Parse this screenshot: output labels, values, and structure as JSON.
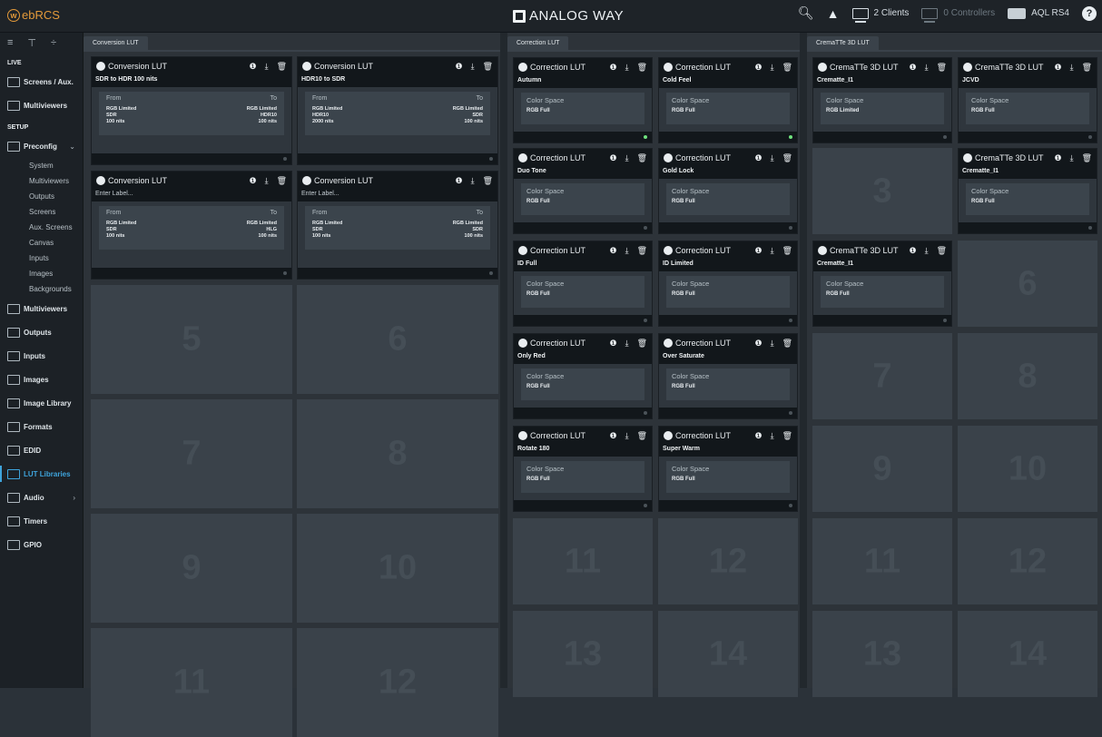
{
  "app": {
    "name": "ebRCS",
    "brand": "ANALOG WAY",
    "clients": "2 Clients",
    "controllers": "0 Controllers",
    "device": "AQL RS4",
    "help": "?"
  },
  "sidebar": {
    "live": "LIVE",
    "setup": "SETUP",
    "live_items": [
      "Screens / Aux.",
      "Multiviewers"
    ],
    "preconfig": "Preconfig",
    "preconfig_sub": [
      "System",
      "Multiviewers",
      "Outputs",
      "Screens",
      "Aux. Screens",
      "Canvas",
      "Inputs",
      "Images",
      "Backgrounds"
    ],
    "items": [
      "Multiviewers",
      "Outputs",
      "Inputs",
      "Images",
      "Image Library",
      "Formats",
      "EDID",
      "LUT Libraries",
      "Audio",
      "Timers",
      "GPIO"
    ]
  },
  "conversion": {
    "tab": "Conversion LUT",
    "cards": [
      {
        "title": "Conversion LUT",
        "label": "SDR to HDR 100 nits",
        "from_label": "From",
        "to_label": "To",
        "from": [
          "RGB Limited",
          "SDR",
          "100 nits"
        ],
        "to": [
          "RGB Limited",
          "HDR10",
          "100 nits"
        ]
      },
      {
        "title": "Conversion LUT",
        "label": "HDR10 to SDR",
        "from_label": "From",
        "to_label": "To",
        "from": [
          "RGB Limited",
          "HDR10",
          "2000 nits"
        ],
        "to": [
          "RGB Limited",
          "SDR",
          "100 nits"
        ]
      },
      {
        "title": "Conversion LUT",
        "label": "Enter Label...",
        "from_label": "From",
        "to_label": "To",
        "from": [
          "RGB Limited",
          "SDR",
          "100 nits"
        ],
        "to": [
          "RGB Limited",
          "HLG",
          "100 nits"
        ]
      },
      {
        "title": "Conversion LUT",
        "label": "Enter Label...",
        "from_label": "From",
        "to_label": "To",
        "from": [
          "RGB Limited",
          "SDR",
          "100 nits"
        ],
        "to": [
          "RGB Limited",
          "SDR",
          "100 nits"
        ]
      }
    ],
    "empty": [
      "5",
      "6",
      "7",
      "8",
      "9",
      "10",
      "11",
      "12"
    ]
  },
  "correction": {
    "tab": "Correction LUT",
    "cards": [
      {
        "title": "Correction LUT",
        "label": "Autumn",
        "cs_label": "Color Space",
        "cs": "RGB Full"
      },
      {
        "title": "Correction LUT",
        "label": "Cold Feel",
        "cs_label": "Color Space",
        "cs": "RGB Full"
      },
      {
        "title": "Correction LUT",
        "label": "Duo Tone",
        "cs_label": "Color Space",
        "cs": "RGB Full"
      },
      {
        "title": "Correction LUT",
        "label": "Gold Lock",
        "cs_label": "Color Space",
        "cs": "RGB Full"
      },
      {
        "title": "Correction LUT",
        "label": "ID Full",
        "cs_label": "Color Space",
        "cs": "RGB Full"
      },
      {
        "title": "Correction LUT",
        "label": "ID Limited",
        "cs_label": "Color Space",
        "cs": "RGB Full"
      },
      {
        "title": "Correction LUT",
        "label": "Only Red",
        "cs_label": "Color Space",
        "cs": "RGB Full"
      },
      {
        "title": "Correction LUT",
        "label": "Over Saturate",
        "cs_label": "Color Space",
        "cs": "RGB Full"
      },
      {
        "title": "Correction LUT",
        "label": "Rotate 180",
        "cs_label": "Color Space",
        "cs": "RGB Full"
      },
      {
        "title": "Correction LUT",
        "label": "Super Warm",
        "cs_label": "Color Space",
        "cs": "RGB Full"
      }
    ],
    "empty": [
      "11",
      "12",
      "13",
      "14"
    ]
  },
  "crematte": {
    "tab": "CremaTTe 3D LUT",
    "cards": [
      {
        "title": "CremaTTe 3D LUT",
        "label": "Crematte_I1",
        "cs_label": "Color Space",
        "cs": "RGB Limited"
      },
      {
        "title": "CremaTTe 3D LUT",
        "label": "JCVD",
        "cs_label": "Color Space",
        "cs": "RGB Full"
      },
      {
        "title": "CremaTTe 3D LUT",
        "label": "Crematte_I1",
        "cs_label": "Color Space",
        "cs": "RGB Full"
      },
      {
        "title": "CremaTTe 3D LUT",
        "label": "Crematte_I1",
        "cs_label": "Color Space",
        "cs": "RGB Full"
      }
    ],
    "empty": [
      "3",
      "6",
      "7",
      "8",
      "9",
      "10",
      "11",
      "12",
      "13",
      "14"
    ]
  }
}
